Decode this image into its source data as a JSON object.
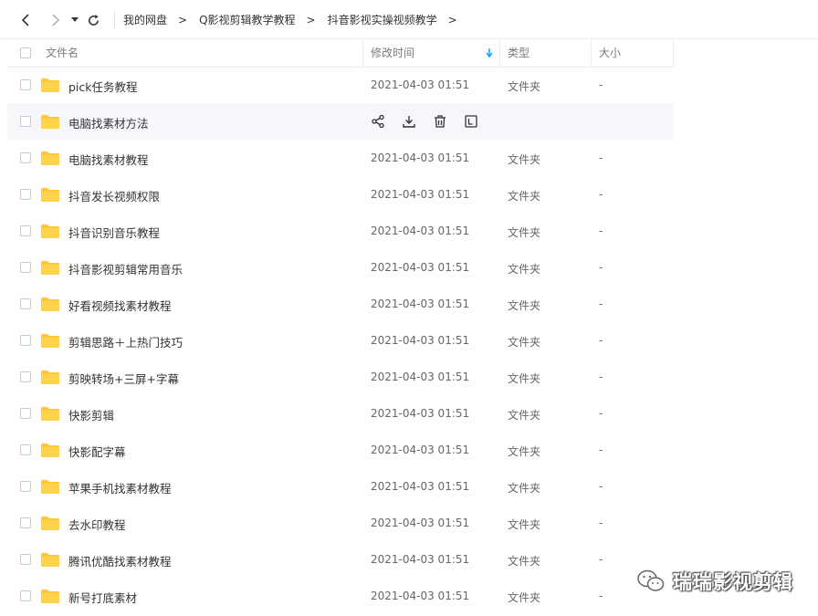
{
  "toolbar": {
    "back_icon": "chevron-left-icon",
    "forward_icon": "chevron-right-icon",
    "history_icon": "caret-down-icon",
    "refresh_icon": "refresh-icon"
  },
  "breadcrumb": {
    "items": [
      "我的网盘",
      "Q影视剪辑教学教程",
      "抖音影视实操视频教学"
    ],
    "separator": ">"
  },
  "table": {
    "headers": {
      "name": "文件名",
      "modified": "修改时间",
      "type": "类型",
      "size": "大小"
    },
    "sort_indicator": "arrow-down-icon",
    "rows": [
      {
        "name": "pick任务教程",
        "modified": "2021-04-03 01:51",
        "type": "文件夹",
        "size": "-"
      },
      {
        "name": "电脑找素材方法",
        "modified": "",
        "type": "",
        "size": "",
        "hover": true
      },
      {
        "name": "电脑找素材教程",
        "modified": "2021-04-03 01:51",
        "type": "文件夹",
        "size": "-"
      },
      {
        "name": "抖音发长视频权限",
        "modified": "2021-04-03 01:51",
        "type": "文件夹",
        "size": "-"
      },
      {
        "name": "抖音识别音乐教程",
        "modified": "2021-04-03 01:51",
        "type": "文件夹",
        "size": "-"
      },
      {
        "name": "抖音影视剪辑常用音乐",
        "modified": "2021-04-03 01:51",
        "type": "文件夹",
        "size": "-"
      },
      {
        "name": "好看视频找素材教程",
        "modified": "2021-04-03 01:51",
        "type": "文件夹",
        "size": "-"
      },
      {
        "name": "剪辑思路＋上热门技巧",
        "modified": "2021-04-03 01:51",
        "type": "文件夹",
        "size": "-"
      },
      {
        "name": "剪映转场+三屏+字幕",
        "modified": "2021-04-03 01:51",
        "type": "文件夹",
        "size": "-"
      },
      {
        "name": "快影剪辑",
        "modified": "2021-04-03 01:51",
        "type": "文件夹",
        "size": "-"
      },
      {
        "name": "快影配字幕",
        "modified": "2021-04-03 01:51",
        "type": "文件夹",
        "size": "-"
      },
      {
        "name": "苹果手机找素材教程",
        "modified": "2021-04-03 01:51",
        "type": "文件夹",
        "size": "-"
      },
      {
        "name": "去水印教程",
        "modified": "2021-04-03 01:51",
        "type": "文件夹",
        "size": "-"
      },
      {
        "name": "腾讯优酷找素材教程",
        "modified": "2021-04-03 01:51",
        "type": "文件夹",
        "size": "-"
      },
      {
        "name": "新号打底素材",
        "modified": "2021-04-03 01:51",
        "type": "文件夹",
        "size": "-"
      }
    ],
    "hover_actions": [
      "share-icon",
      "download-icon",
      "delete-icon",
      "rename-icon"
    ]
  },
  "watermark": {
    "text": "瑞瑞影视剪辑",
    "icon": "wechat-icon"
  },
  "colors": {
    "folder": "#FFC933",
    "accent": "#06a7ff",
    "hover_row": "#f5f7fa"
  }
}
